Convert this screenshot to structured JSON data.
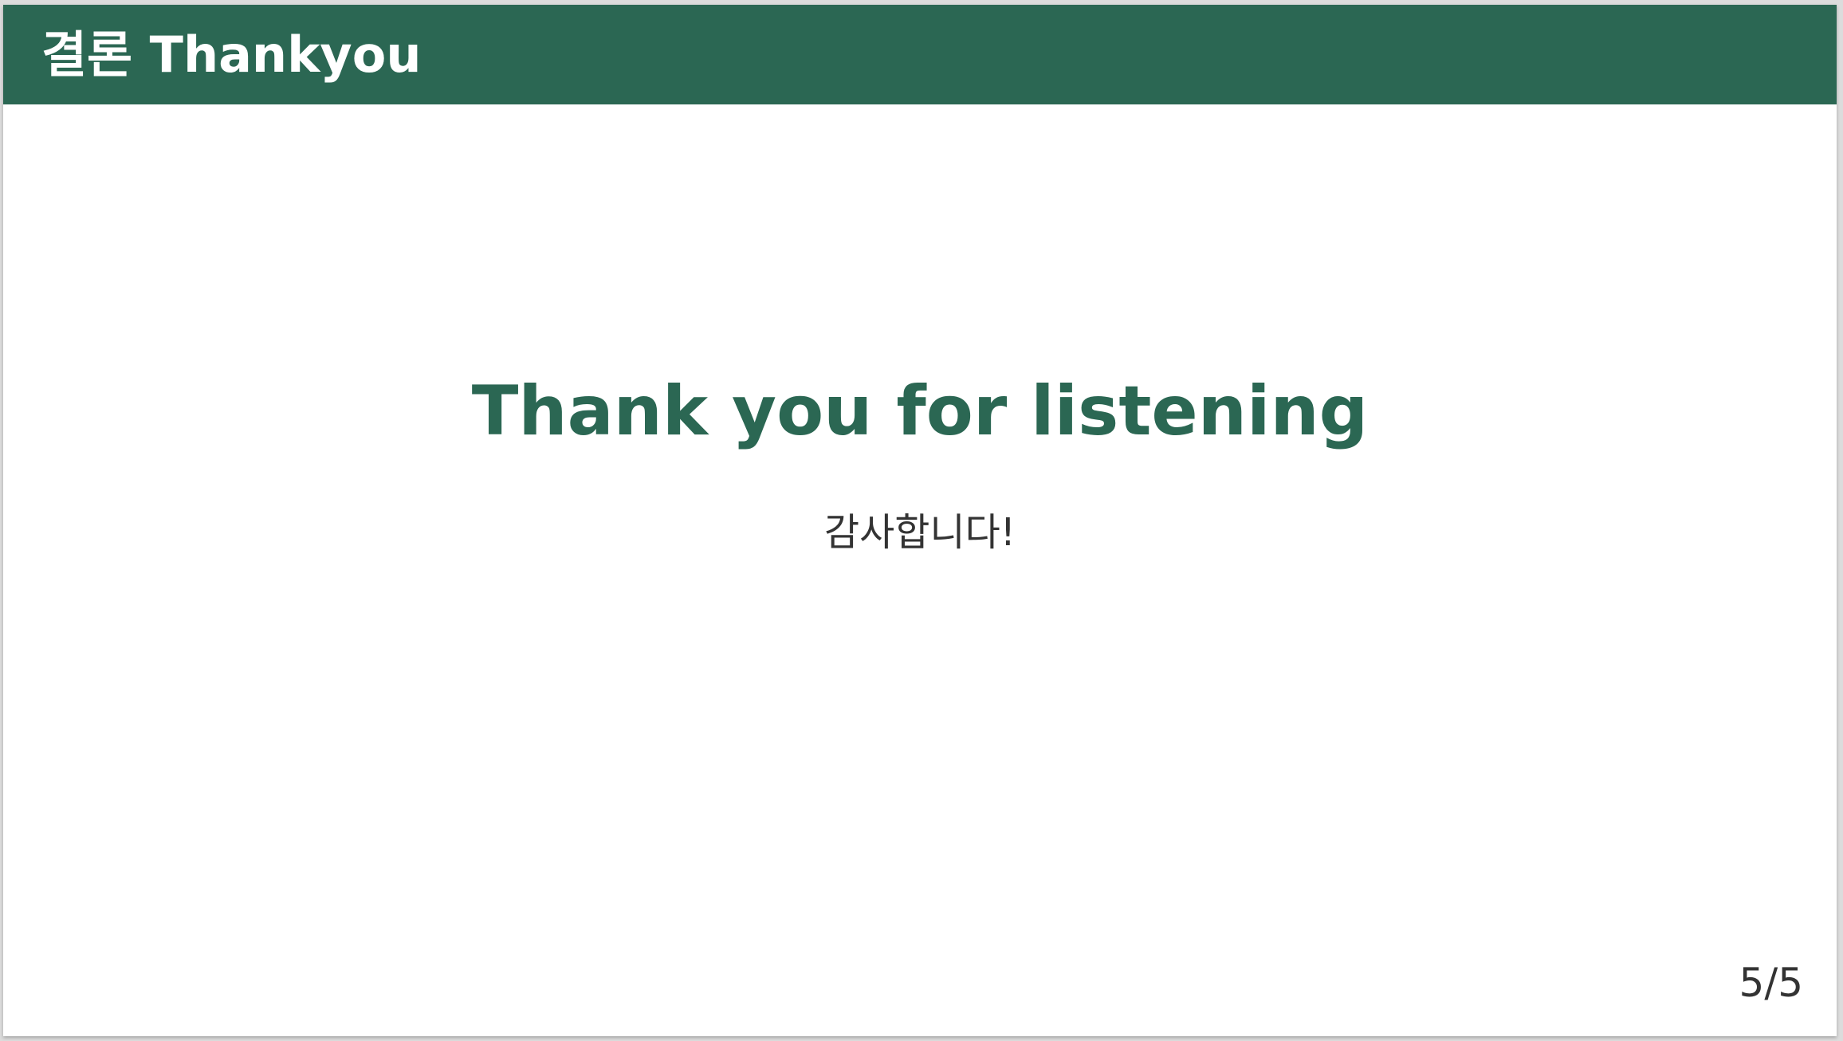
{
  "header": {
    "title": "결론 Thankyou"
  },
  "main": {
    "title": "Thank you for listening",
    "subtitle": "감사합니다!"
  },
  "footer": {
    "page_number": "5/5"
  },
  "colors": {
    "accent": "#2b6753",
    "text": "#333333",
    "background": "#ffffff"
  }
}
